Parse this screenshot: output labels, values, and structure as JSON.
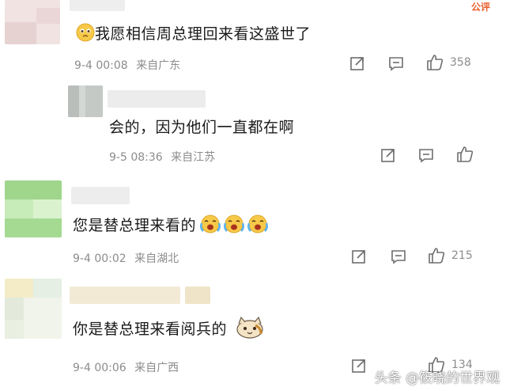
{
  "colors": {
    "meta": "#8c8c8c",
    "text": "#1a1a1a",
    "icon": "#6e6e6e",
    "logo": "#e8602c"
  },
  "corner_logo": "公评",
  "comments": [
    {
      "text": "我愿相信周总理回来看这盛世了",
      "lead_emoji": "pleading-face-emoji",
      "time": "9-4 00:08",
      "location": "来自广东",
      "likes": "358"
    },
    {
      "text": "会的，因为他们一直都在啊",
      "time": "9-5 08:36",
      "location": "来自江苏",
      "likes": ""
    },
    {
      "text": "您是替总理来看的",
      "trail_emoji": [
        "crying-face-emoji",
        "crying-face-emoji",
        "crying-face-emoji"
      ],
      "time": "9-4 00:02",
      "location": "来自湖北",
      "likes": "215"
    },
    {
      "text": "你是替总理来看阅兵的",
      "trail_emoji": [
        "cat-emoji"
      ],
      "time": "9-4 00:06",
      "location": "来自广西",
      "likes": "134"
    }
  ],
  "watermark": "头条 @筱晓的世界观"
}
